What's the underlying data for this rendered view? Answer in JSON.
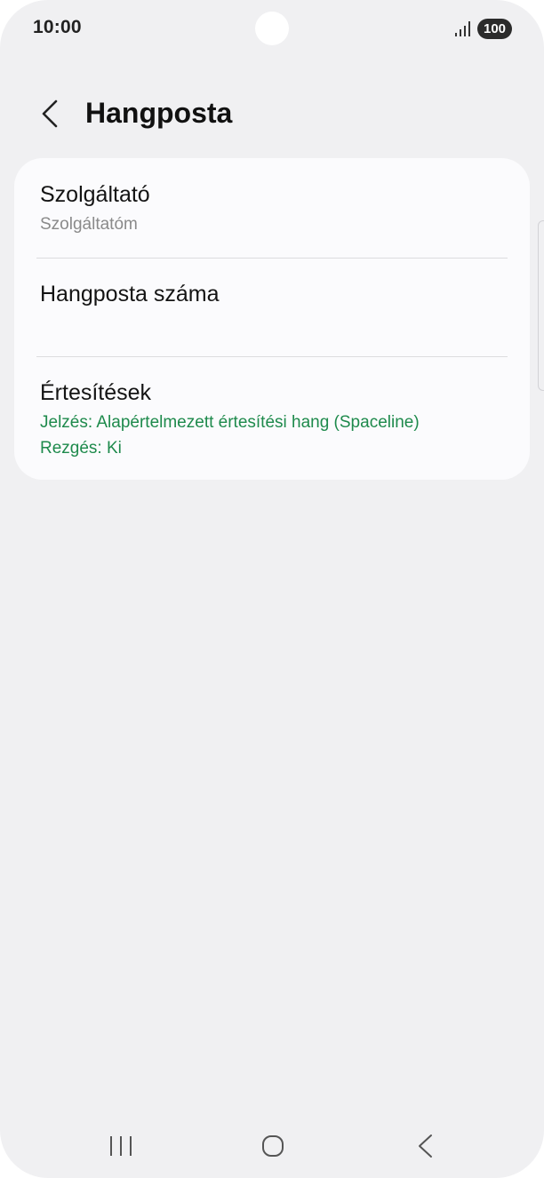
{
  "status_bar": {
    "time": "10:00",
    "battery": "100",
    "icons": [
      "signal-icon",
      "battery-icon"
    ]
  },
  "header": {
    "title": "Hangposta",
    "back_icon": "chevron-left-icon"
  },
  "settings": {
    "items": [
      {
        "title": "Szolgáltató",
        "subtitle": "Szolgáltatóm"
      },
      {
        "title": "Hangposta száma"
      },
      {
        "title": "Értesítések",
        "subtitle_lines": [
          "Jelzés: Alapértelmezett értesítési hang (Spaceline)",
          "Rezgés: Ki"
        ]
      }
    ]
  },
  "nav_bar": {
    "icons": [
      "recent-apps-icon",
      "home-icon",
      "back-icon"
    ]
  },
  "colors": {
    "background": "#f0f0f2",
    "card": "#fbfbfd",
    "accent_green": "#1e8a4c",
    "secondary_text": "#8a8a8a"
  }
}
